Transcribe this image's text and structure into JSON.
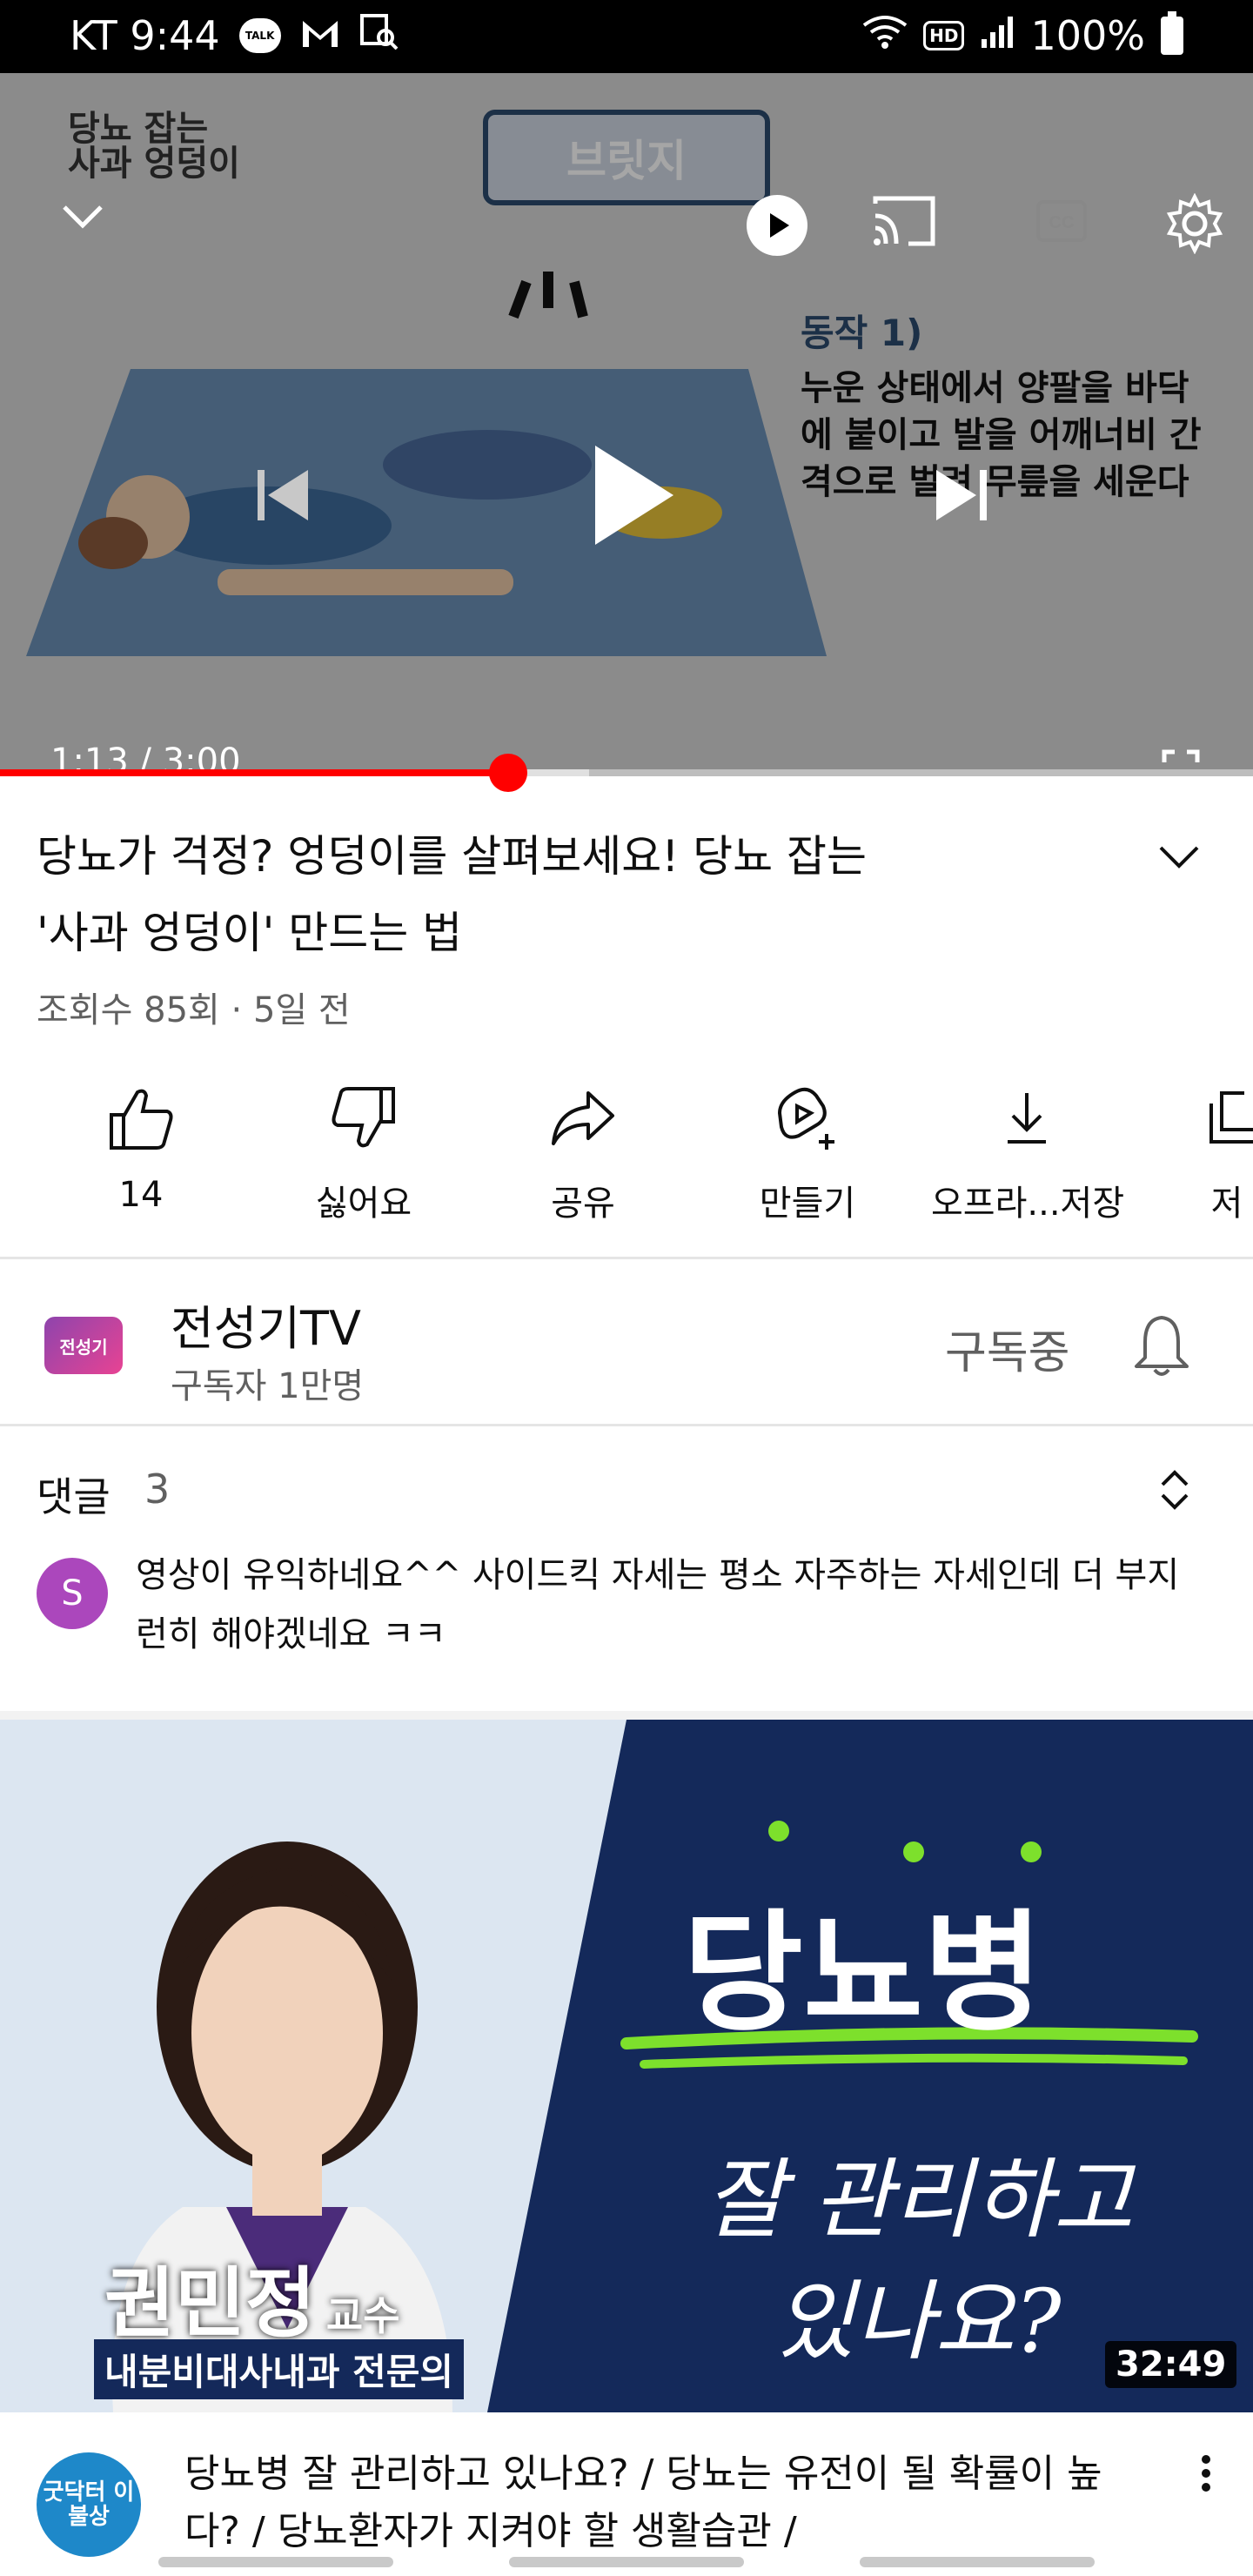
{
  "status_bar": {
    "carrier_time": "KT 9:44",
    "talk": "TALK",
    "hd": "HD",
    "battery": "100%"
  },
  "player": {
    "channel_logo_line1": "당뇨 잡는",
    "channel_logo_line2": "사과 엉덩이",
    "brand_badge": "브릿지",
    "step_title": "동작 1)",
    "step_text": "누운 상태에서 양팔을 바닥에 붙이고 발을 어깨너비 간격으로 벌려 무릎을 세운다",
    "time": "1:13 / 3:00",
    "progress": 0.4056,
    "buffered": 0.47,
    "icons": [
      "chevron-down-icon",
      "play-icon",
      "cast-icon",
      "cc-icon",
      "gear-icon",
      "skip-previous-icon",
      "play-icon",
      "skip-next-icon",
      "fullscreen-icon"
    ]
  },
  "video": {
    "title_line1": "당뇨가 걱정? 엉덩이를 살펴보세요! 당뇨 잡는",
    "title_line2": "'사과 엉덩이' 만드는 법",
    "meta": "조회수 85회 · 5일 전"
  },
  "actions": [
    {
      "label": "14",
      "icon": "thumbs-up-icon"
    },
    {
      "label": "싫어요",
      "icon": "thumbs-down-icon"
    },
    {
      "label": "공유",
      "icon": "share-icon"
    },
    {
      "label": "만들기",
      "icon": "create-icon"
    },
    {
      "label": "오프라...저장",
      "icon": "download-icon"
    },
    {
      "label": "저",
      "icon": "save-icon"
    }
  ],
  "channel": {
    "name": "전성기TV",
    "subscribers": "구독자 1만명",
    "subscribed_label": "구독중",
    "avatar_text": "전성기"
  },
  "comments": {
    "title": "댓글",
    "count": "3",
    "top_comment": {
      "avatar_letter": "S",
      "text": "영상이 유익하네요^^  사이드킥 자세는 평소 자주하는 자세인데 더 부지런히 해야겠네요 ㅋㅋ"
    }
  },
  "recommended": {
    "thumb_headline": "당뇨병",
    "thumb_subline1": "잘 관리하고",
    "thumb_subline2": "있나요?",
    "person_name": "권민정",
    "person_title": "교수",
    "person_dept": "내분비대사내과 전문의",
    "duration": "32:49",
    "avatar_text": "굿닥터 이불상",
    "title": "당뇨병 잘 관리하고 있나요? / 당뇨는 유전이 될 확률이 높다? / 당뇨환자가 지켜야 할 생활습관 /"
  },
  "colors": {
    "accent_red": "#ff0000",
    "text_primary": "#0f0f0f",
    "text_secondary": "#606060",
    "thumb_navy": "#14295a",
    "thumb_green": "#7de02c"
  }
}
